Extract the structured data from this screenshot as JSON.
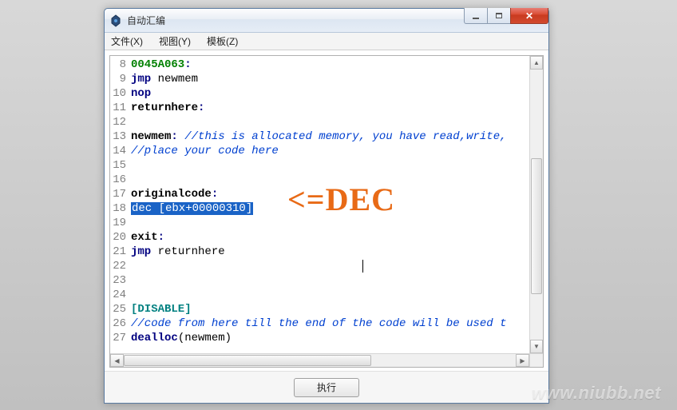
{
  "window": {
    "title": "自动汇编"
  },
  "menu": {
    "file": "文件(X)",
    "view": "视图(Y)",
    "template": "模板(Z)"
  },
  "footer": {
    "execute": "执行"
  },
  "overlay": {
    "dec": "<=DEC"
  },
  "watermark": "www.niubb.net",
  "code": {
    "lines": [
      {
        "n": 8,
        "seg": [
          {
            "t": "0045A063",
            "c": "green bold"
          },
          {
            "t": ":",
            "c": "navy bold"
          }
        ]
      },
      {
        "n": 9,
        "seg": [
          {
            "t": "jmp",
            "c": "navy bold"
          },
          {
            "t": " newmem",
            "c": "plain"
          }
        ]
      },
      {
        "n": 10,
        "seg": [
          {
            "t": "nop",
            "c": "navy bold"
          }
        ]
      },
      {
        "n": 11,
        "seg": [
          {
            "t": "returnhere",
            "c": "plain bold"
          },
          {
            "t": ":",
            "c": "navy bold"
          }
        ]
      },
      {
        "n": 12,
        "seg": []
      },
      {
        "n": 13,
        "seg": [
          {
            "t": "newmem",
            "c": "plain bold"
          },
          {
            "t": ":",
            "c": "navy bold"
          },
          {
            "t": " ",
            "c": "plain"
          },
          {
            "t": "//this is allocated memory, you have read,write,",
            "c": "blueit"
          }
        ]
      },
      {
        "n": 14,
        "seg": [
          {
            "t": "//place your code here",
            "c": "blueit"
          }
        ]
      },
      {
        "n": 15,
        "seg": []
      },
      {
        "n": 16,
        "seg": []
      },
      {
        "n": 17,
        "seg": [
          {
            "t": "originalcode",
            "c": "plain bold"
          },
          {
            "t": ":",
            "c": "navy bold"
          }
        ]
      },
      {
        "n": 18,
        "seg": [
          {
            "t": "dec [ebx+00000310]",
            "c": "sel"
          }
        ],
        "overlay": "dec"
      },
      {
        "n": 19,
        "seg": []
      },
      {
        "n": 20,
        "seg": [
          {
            "t": "exit",
            "c": "plain bold"
          },
          {
            "t": ":",
            "c": "navy bold"
          }
        ]
      },
      {
        "n": 21,
        "seg": [
          {
            "t": "jmp",
            "c": "navy bold"
          },
          {
            "t": " returnhere",
            "c": "plain"
          }
        ]
      },
      {
        "n": 22,
        "seg": [],
        "caret": true
      },
      {
        "n": 23,
        "seg": []
      },
      {
        "n": 24,
        "seg": []
      },
      {
        "n": 25,
        "seg": [
          {
            "t": "[DISABLE]",
            "c": "teal bold"
          }
        ]
      },
      {
        "n": 26,
        "seg": [
          {
            "t": "//code from here till the end of the code will be used t",
            "c": "blueit"
          }
        ]
      },
      {
        "n": 27,
        "seg": [
          {
            "t": "dealloc",
            "c": "navy bold"
          },
          {
            "t": "(newmem)",
            "c": "plain"
          }
        ]
      }
    ]
  }
}
